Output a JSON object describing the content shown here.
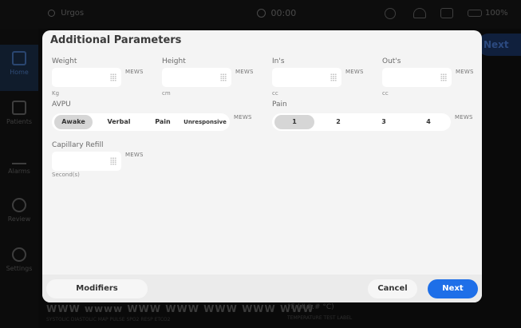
{
  "topbar": {
    "user": "Urgos",
    "clock": "00:00",
    "battery": "100%"
  },
  "sidebar": {
    "items": [
      {
        "label": "Home",
        "icon": "home-icon"
      },
      {
        "label": "Patients",
        "icon": "patients-icon"
      },
      {
        "label": "Alarms",
        "icon": "alarm-icon"
      },
      {
        "label": "Review",
        "icon": "review-icon"
      },
      {
        "label": "Settings",
        "icon": "settings-icon"
      }
    ]
  },
  "background": {
    "next_label": "Next",
    "footer_values": "WWW wwww WWW WWW WWW WWW WWW",
    "footer_sub": "SYSTOLIC   DIASTOLIC   MAP   PULSE   SPO2   RESP   ETCO2",
    "temp_value": "°F (##.# °C)",
    "temp_sub": "TEMPERATURE TEST LABEL"
  },
  "modal": {
    "title": "Additional Parameters",
    "mews_label": "MEWS",
    "fields": {
      "weight": {
        "label": "Weight",
        "unit": "Kg",
        "value": ""
      },
      "height": {
        "label": "Height",
        "unit": "cm",
        "value": ""
      },
      "ins": {
        "label": "In's",
        "unit": "cc",
        "value": ""
      },
      "outs": {
        "label": "Out's",
        "unit": "cc",
        "value": ""
      },
      "capillary": {
        "label": "Capillary Refill",
        "unit": "Second(s)",
        "value": ""
      }
    },
    "avpu": {
      "label": "AVPU",
      "options": [
        "Awake",
        "Verbal",
        "Pain",
        "Unresponsive"
      ],
      "selected": "Awake"
    },
    "pain": {
      "label": "Pain",
      "options": [
        "1",
        "2",
        "3",
        "4"
      ],
      "selected": "1"
    },
    "buttons": {
      "modifiers": "Modifiers",
      "cancel": "Cancel",
      "next": "Next"
    }
  },
  "colors": {
    "accent": "#1e6fe8",
    "modal_bg": "#f4f4f4",
    "selected_option": "#d6d6d6"
  }
}
